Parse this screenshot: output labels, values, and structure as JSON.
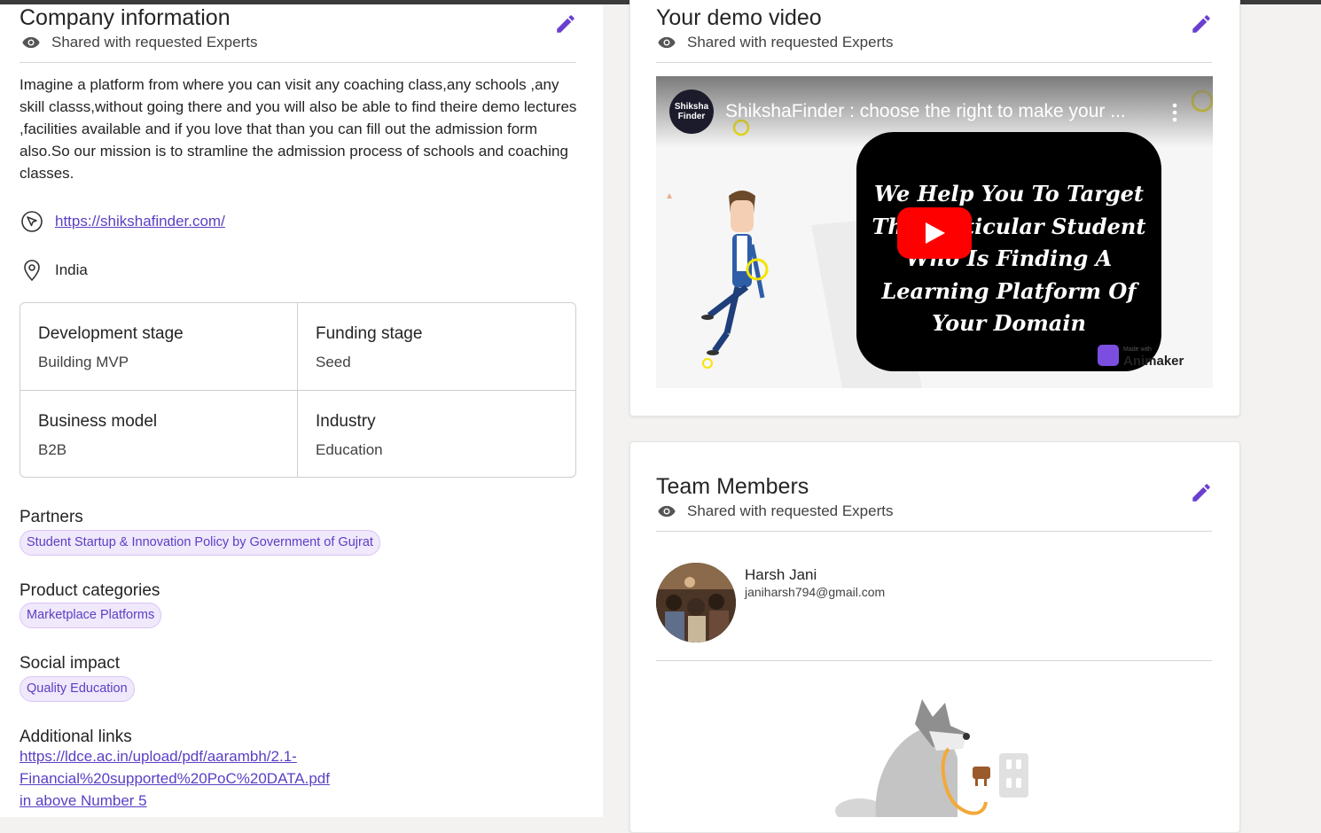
{
  "company": {
    "title": "Company information",
    "shared_label": "Shared with requested Experts",
    "description": "Imagine a platform from where you can visit any coaching class,any schools ,any skill classs,without going there and you will also be able to find theire demo lectures ,facilities available and if you love that than you can fill out the admission form also.So our mission is to stramline the admission process of schools and coaching classes.",
    "website": "https://shikshafinder.com/",
    "location": "India",
    "details": {
      "development_stage_label": "Development stage",
      "development_stage_value": "Building MVP",
      "funding_stage_label": "Funding stage",
      "funding_stage_value": "Seed",
      "business_model_label": "Business model",
      "business_model_value": "B2B",
      "industry_label": "Industry",
      "industry_value": "Education"
    },
    "partners_label": "Partners",
    "partners": [
      "Student Startup & Innovation Policy by Government of Gujrat"
    ],
    "product_categories_label": "Product categories",
    "product_categories": [
      "Marketplace Platforms"
    ],
    "social_impact_label": "Social impact",
    "social_impact": [
      "Quality Education"
    ],
    "additional_links_label": "Additional links",
    "additional_links": [
      "https://ldce.ac.in/upload/pdf/aarambh/2.1-",
      "Financial%20supported%20PoC%20DATA.pdf",
      "in above Number 5"
    ]
  },
  "demo_video": {
    "title": "Your demo video",
    "shared_label": "Shared with requested Experts",
    "channel_logo_text": "Shiksha Finder",
    "video_title": "ShikshaFinder : choose the right to make your ...",
    "thumbnail_lines": [
      "We Help You To Target",
      "The Particular Student",
      "Who Is  Finding A",
      "Learning Platform Of",
      "Your Domain"
    ],
    "watermark_small": "Made with",
    "watermark": "Animaker"
  },
  "team": {
    "title": "Team Members",
    "shared_label": "Shared with requested Experts",
    "members": [
      {
        "name": "Harsh Jani",
        "email": "janiharsh794@gmail.com"
      }
    ]
  },
  "colors": {
    "accent": "#5b3fc4",
    "chip_bg": "#f0e8fb",
    "youtube_red": "#ff0000"
  },
  "icons": [
    "eye-icon",
    "pencil-edit-icon",
    "website-icon",
    "location-pin-icon",
    "play-icon",
    "more-vertical-icon"
  ]
}
